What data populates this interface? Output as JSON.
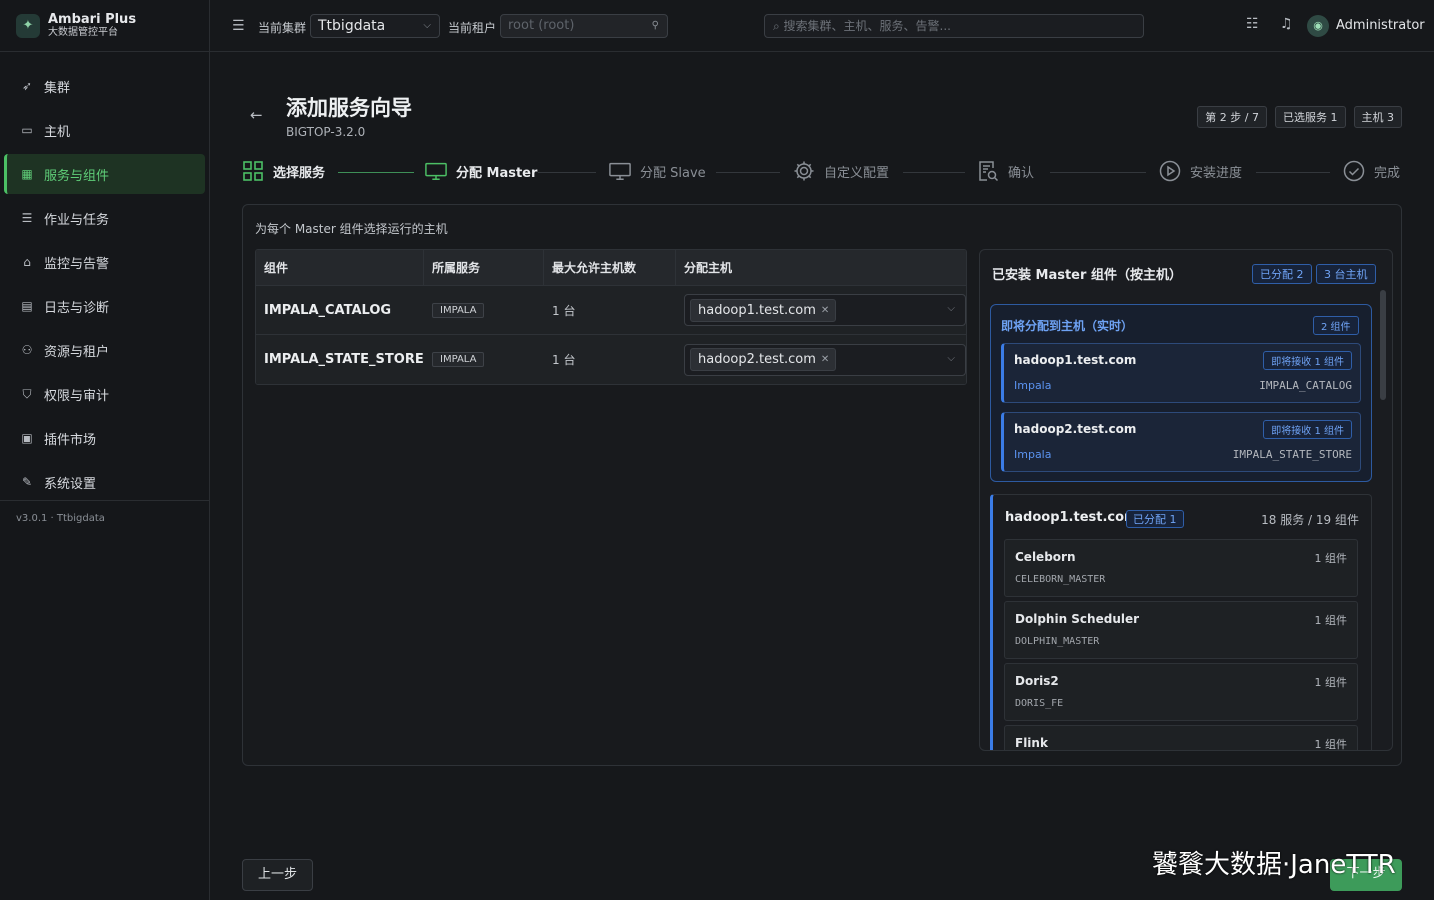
{
  "app": {
    "title": "Ambari Plus",
    "subtitle": "大数据管控平台",
    "version": "v3.0.1 · Ttbigdata"
  },
  "sidebar": {
    "items": [
      {
        "label": "集群",
        "icon": "rocket-icon"
      },
      {
        "label": "主机",
        "icon": "monitor-icon"
      },
      {
        "label": "服务与组件",
        "icon": "grid-icon",
        "active": true
      },
      {
        "label": "作业与任务",
        "icon": "list-icon"
      },
      {
        "label": "监控与告警",
        "icon": "alarm-icon"
      },
      {
        "label": "日志与诊断",
        "icon": "document-icon"
      },
      {
        "label": "资源与租户",
        "icon": "users-icon"
      },
      {
        "label": "权限与审计",
        "icon": "shield-icon"
      },
      {
        "label": "插件市场",
        "icon": "apps-icon"
      },
      {
        "label": "系统设置",
        "icon": "wrench-icon"
      }
    ]
  },
  "topbar": {
    "cluster_label": "当前集群",
    "cluster_value": "Ttbigdata",
    "tenant_label": "当前租户",
    "tenant_value": "root (root)",
    "search_placeholder": "搜索集群、主机、服务、告警...",
    "user": "Administrator"
  },
  "wizard": {
    "title": "添加服务向导",
    "stack": "BIGTOP-3.2.0",
    "badges": [
      "第 2 步 / 7",
      "已选服务 1",
      "主机 3"
    ],
    "steps": [
      {
        "label": "选择服务",
        "state": "done",
        "icon": "grid-icon"
      },
      {
        "label": "分配 Master",
        "state": "current",
        "icon": "monitor-icon"
      },
      {
        "label": "分配 Slave",
        "state": "pending",
        "icon": "monitor-icon"
      },
      {
        "label": "自定义配置",
        "state": "pending",
        "icon": "gear-icon"
      },
      {
        "label": "确认",
        "state": "pending",
        "icon": "document-search-icon"
      },
      {
        "label": "安装进度",
        "state": "pending",
        "icon": "play-icon"
      },
      {
        "label": "完成",
        "state": "pending",
        "icon": "check-circle-icon"
      }
    ]
  },
  "assign": {
    "hint": "为每个 Master 组件选择运行的主机",
    "columns": [
      "组件",
      "所属服务",
      "最大允许主机数",
      "分配主机"
    ],
    "rows": [
      {
        "component": "IMPALA_CATALOG",
        "service": "IMPALA",
        "max": "1 台",
        "host": "hadoop1.test.com"
      },
      {
        "component": "IMPALA_STATE_STORE",
        "service": "IMPALA",
        "max": "1 台",
        "host": "hadoop2.test.com"
      }
    ]
  },
  "installed": {
    "title": "已安装 Master 组件（按主机）",
    "assigned_badge": "已分配 2",
    "hosts_badge": "3 台主机",
    "pending": {
      "title": "即将分配到主机（实时）",
      "count": "2 组件",
      "cards": [
        {
          "host": "hadoop1.test.com",
          "badge": "即将接收 1 组件",
          "service": "Impala",
          "component": "IMPALA_CATALOG"
        },
        {
          "host": "hadoop2.test.com",
          "badge": "即将接收 1 组件",
          "service": "Impala",
          "component": "IMPALA_STATE_STORE"
        }
      ]
    },
    "host_block": {
      "host": "hadoop1.test.com",
      "tag": "已分配 1",
      "count": "18 服务 / 19 组件",
      "services": [
        {
          "name": "Celeborn",
          "count": "1 组件",
          "component": "CELEBORN_MASTER"
        },
        {
          "name": "Dolphin Scheduler",
          "count": "1 组件",
          "component": "DOLPHIN_MASTER"
        },
        {
          "name": "Doris2",
          "count": "1 组件",
          "component": "DORIS_FE"
        },
        {
          "name": "Flink",
          "count": "1 组件",
          "component": ""
        }
      ]
    }
  },
  "footer": {
    "prev": "上一步",
    "next": "下一步"
  },
  "watermark": "饕餮大数据·JaneTTR",
  "colors": {
    "accent_green": "#4cbf65",
    "accent_blue": "#3b7ce6",
    "bg": "#16181b"
  }
}
